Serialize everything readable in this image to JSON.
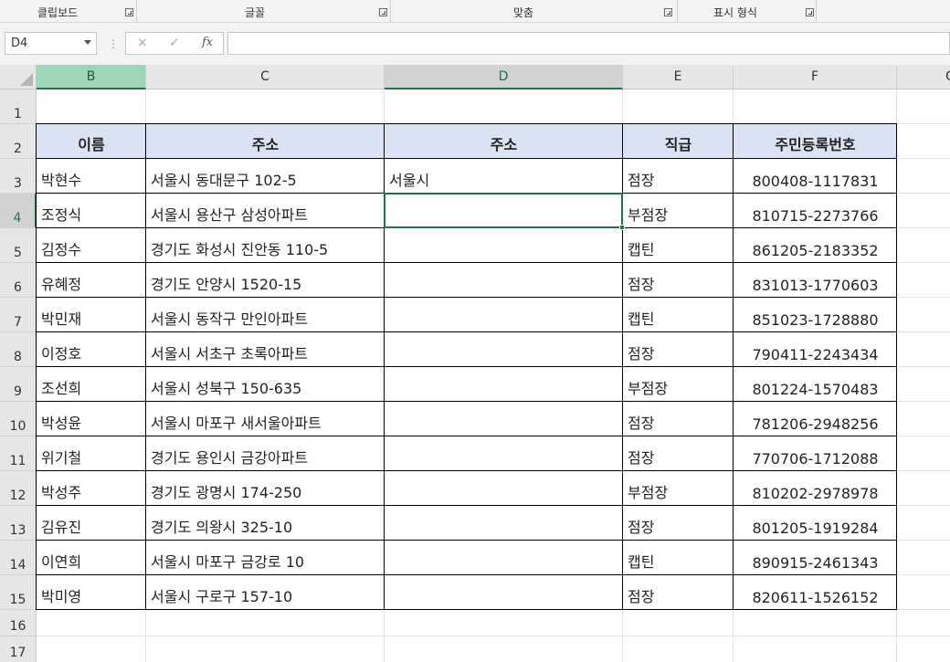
{
  "ribbon": {
    "groups": [
      {
        "label": "클립보드"
      },
      {
        "label": "글꼴"
      },
      {
        "label": "맞춤"
      },
      {
        "label": "표시 형식"
      }
    ]
  },
  "formula_bar": {
    "name_box": "D4",
    "cancel_icon": "×",
    "enter_icon": "✓",
    "fx_label": "fx",
    "formula_value": ""
  },
  "columns": [
    {
      "letter": "B"
    },
    {
      "letter": "C"
    },
    {
      "letter": "D"
    },
    {
      "letter": "E"
    },
    {
      "letter": "F"
    },
    {
      "letter": "G"
    }
  ],
  "rows": [
    "1",
    "2",
    "3",
    "4",
    "5",
    "6",
    "7",
    "8",
    "9",
    "10",
    "11",
    "12",
    "13",
    "14",
    "15",
    "16",
    "17"
  ],
  "table": {
    "headers": [
      "이름",
      "주소",
      "주소",
      "직급",
      "주민등록번호"
    ],
    "data": [
      [
        "박현수",
        "서울시 동대문구 102-5",
        "서울시",
        "점장",
        "800408-1117831"
      ],
      [
        "조정식",
        "서울시 용산구 삼성아파트",
        "",
        "부점장",
        "810715-2273766"
      ],
      [
        "김정수",
        "경기도 화성시 진안동 110-5",
        "",
        "캡틴",
        "861205-2183352"
      ],
      [
        "유혜정",
        "경기도 안양시 1520-15",
        "",
        "점장",
        "831013-1770603"
      ],
      [
        "박민재",
        "서울시 동작구 만인아파트",
        "",
        "캡틴",
        "851023-1728880"
      ],
      [
        "이정호",
        "서울시 서초구 초록아파트",
        "",
        "점장",
        "790411-2243434"
      ],
      [
        "조선희",
        "서울시 성북구 150-635",
        "",
        "부점장",
        "801224-1570483"
      ],
      [
        "박성윤",
        "서울시 마포구 새서울아파트",
        "",
        "점장",
        "781206-2948256"
      ],
      [
        "위기철",
        "경기도 용인시 금강아파트",
        "",
        "점장",
        "770706-1712088"
      ],
      [
        "박성주",
        "경기도 광명시 174-250",
        "",
        "부점장",
        "810202-2978978"
      ],
      [
        "김유진",
        "경기도 의왕시 325-10",
        "",
        "점장",
        "801205-1919284"
      ],
      [
        "이연희",
        "서울시 마포구 금강로 10",
        "",
        "캡틴",
        "890915-2461343"
      ],
      [
        "박미영",
        "서울시 구로구 157-10",
        "",
        "점장",
        "820611-1526152"
      ]
    ]
  },
  "selection": {
    "active_cell": "D4",
    "active_column": "D",
    "active_row": "4"
  },
  "colors": {
    "accent": "#217346",
    "header_fill": "#dae3f3",
    "selected_col_header": "#9fd5b7"
  }
}
